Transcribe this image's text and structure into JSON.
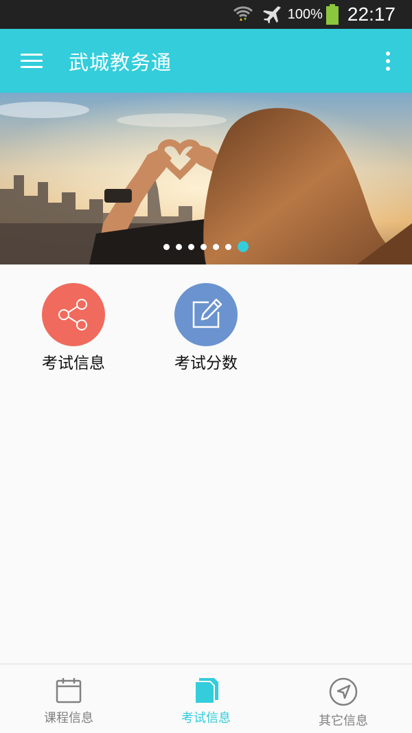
{
  "status_bar": {
    "battery_percent": "100%",
    "time": "22:17",
    "icons": [
      "wifi-icon",
      "airplane-mode-icon",
      "battery-icon"
    ]
  },
  "app_bar": {
    "title": "武城教务通",
    "menu_icon": "menu-icon",
    "overflow_icon": "more-vertical-icon"
  },
  "banner": {
    "slide_count": 7,
    "active_index": 6
  },
  "features": [
    {
      "label": "考试信息",
      "icon": "share-icon",
      "color": "#f06b5d"
    },
    {
      "label": "考试分数",
      "icon": "edit-icon",
      "color": "#6a93cf"
    }
  ],
  "bottom_nav": {
    "items": [
      {
        "label": "课程信息",
        "icon": "calendar-icon",
        "active": false
      },
      {
        "label": "考试信息",
        "icon": "documents-icon",
        "active": true
      },
      {
        "label": "其它信息",
        "icon": "navigation-icon",
        "active": false
      }
    ]
  },
  "colors": {
    "accent": "#33cddb",
    "status_bar": "#222222",
    "background": "#fafafa",
    "inactive": "#808080"
  }
}
